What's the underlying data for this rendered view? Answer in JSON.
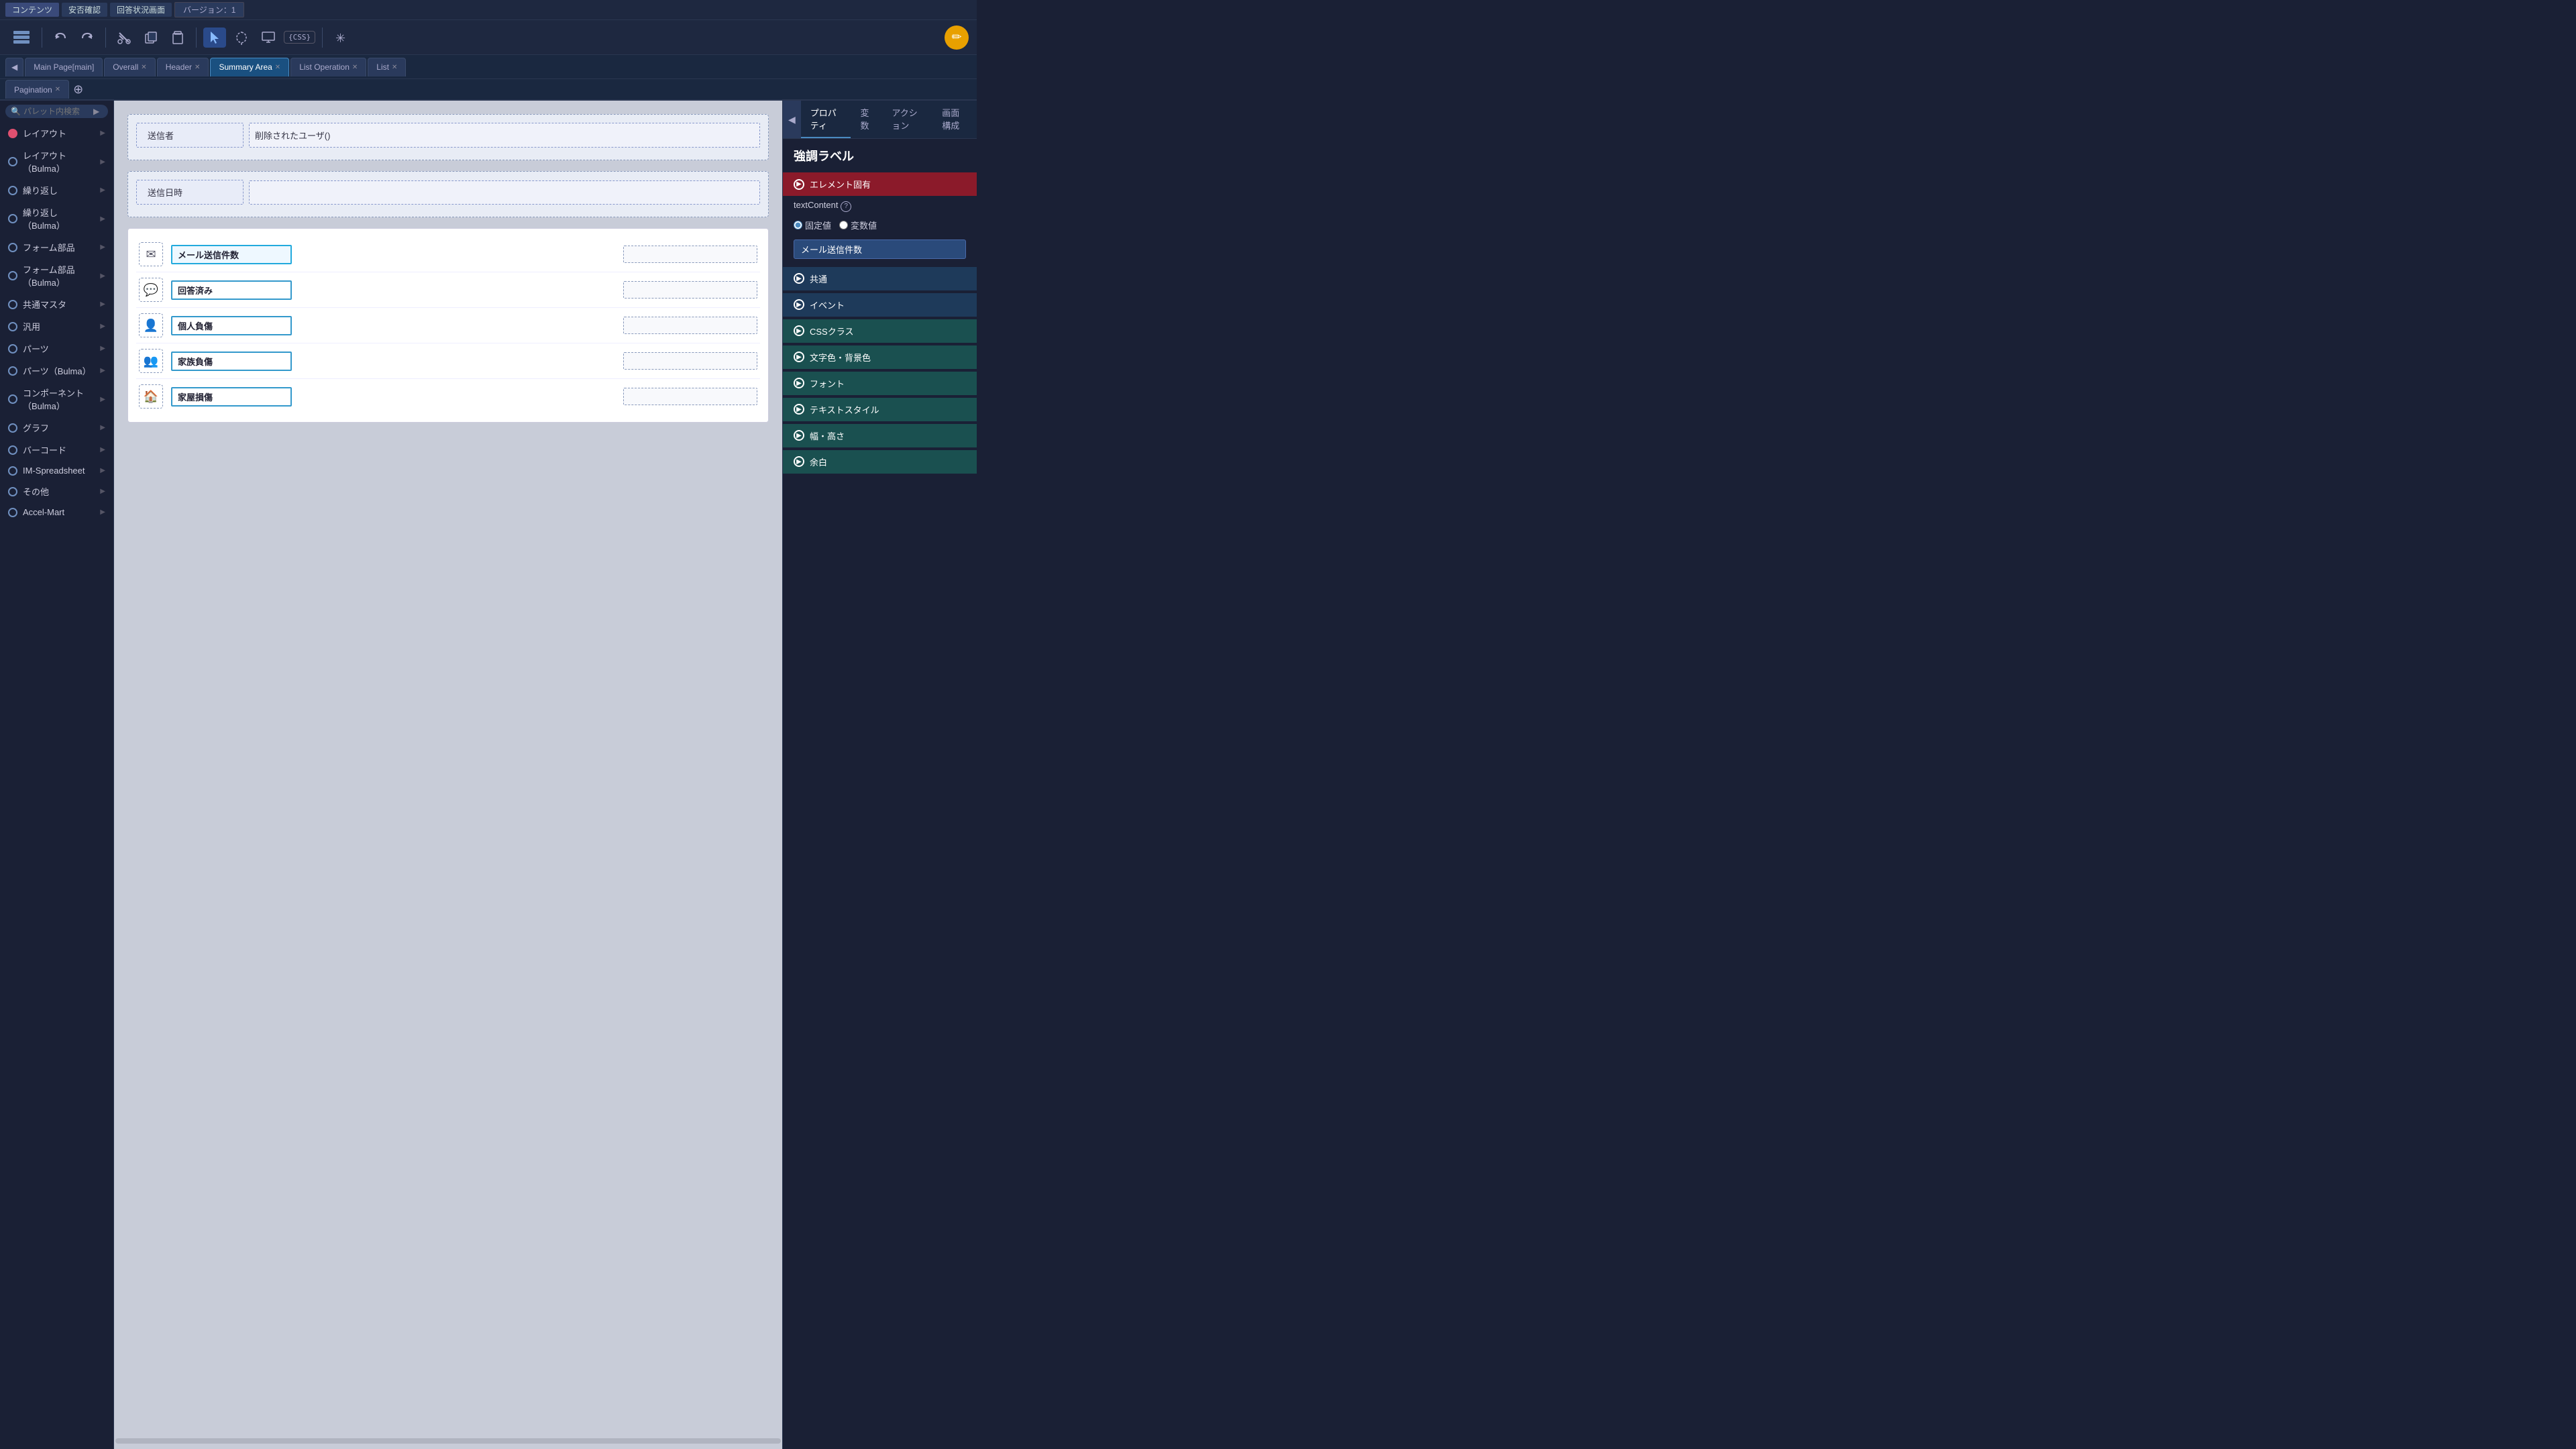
{
  "topbar": {
    "btn1": "コンテンツ",
    "btn2": "安否確認",
    "btn3": "回答状況画面",
    "version": "バージョン：1"
  },
  "toolbar": {
    "undo": "↩",
    "redo": "↪",
    "cut": "✂",
    "copy": "⧉",
    "paste": "📋",
    "select": "▶",
    "lasso": "⌖",
    "monitor": "🖥",
    "css": "CSS",
    "asterisk": "✳"
  },
  "tabs": [
    {
      "label": "Main Page[main]",
      "closable": false,
      "active": false
    },
    {
      "label": "Overall",
      "closable": true,
      "active": false
    },
    {
      "label": "Header",
      "closable": true,
      "active": false
    },
    {
      "label": "Summary Area",
      "closable": true,
      "active": true
    },
    {
      "label": "List Operation",
      "closable": true,
      "active": false
    },
    {
      "label": "List",
      "closable": true,
      "active": false
    }
  ],
  "tabs2": [
    {
      "label": "Pagination",
      "closable": true
    }
  ],
  "sidebar": {
    "search_placeholder": "パレット内検索",
    "items": [
      {
        "label": "レイアウト"
      },
      {
        "label": "レイアウト（Bulma）"
      },
      {
        "label": "繰り返し"
      },
      {
        "label": "繰り返し（Bulma）"
      },
      {
        "label": "フォーム部品"
      },
      {
        "label": "フォーム部品（Bulma）"
      },
      {
        "label": "共通マスタ"
      },
      {
        "label": "汎用"
      },
      {
        "label": "パーツ"
      },
      {
        "label": "パーツ（Bulma）"
      },
      {
        "label": "コンポーネント（Bulma）"
      },
      {
        "label": "グラフ"
      },
      {
        "label": "バーコード"
      },
      {
        "label": "IM-Spreadsheet"
      },
      {
        "label": "その他"
      },
      {
        "label": "Accel-Mart"
      }
    ]
  },
  "canvas": {
    "form_block1": {
      "rows": [
        {
          "label": "送信者",
          "value": "削除されたユーザ()"
        }
      ]
    },
    "form_block2": {
      "rows": [
        {
          "label": "送信日時",
          "value": ""
        }
      ]
    },
    "summary_rows": [
      {
        "icon": "✉",
        "label": "メール送信件数",
        "highlighted": true
      },
      {
        "icon": "💬",
        "label": "回答済み",
        "highlighted": false
      },
      {
        "icon": "👤",
        "label": "個人負傷",
        "highlighted": false
      },
      {
        "icon": "👥",
        "label": "家族負傷",
        "highlighted": false
      },
      {
        "icon": "🏠",
        "label": "家屋損傷",
        "highlighted": false
      }
    ]
  },
  "right_panel": {
    "tabs": [
      "プロパティ",
      "変数",
      "アクション",
      "画面構成"
    ],
    "title": "強調ラベル",
    "sections": [
      {
        "label": "エレメント固有",
        "style": "red-bg"
      },
      {
        "label": "共通",
        "style": "dark-bg"
      },
      {
        "label": "イベント",
        "style": "dark-bg"
      },
      {
        "label": "CSSクラス",
        "style": "teal-bg"
      },
      {
        "label": "文字色・背景色",
        "style": "teal-bg"
      },
      {
        "label": "フォント",
        "style": "teal-bg"
      },
      {
        "label": "テキストスタイル",
        "style": "teal-bg"
      },
      {
        "label": "幅・高さ",
        "style": "teal-bg"
      },
      {
        "label": "余白",
        "style": "teal-bg"
      }
    ],
    "text_content_label": "textContent",
    "fixed_label": "固定値",
    "variable_label": "変数値",
    "input_value": "メール送信件数"
  }
}
